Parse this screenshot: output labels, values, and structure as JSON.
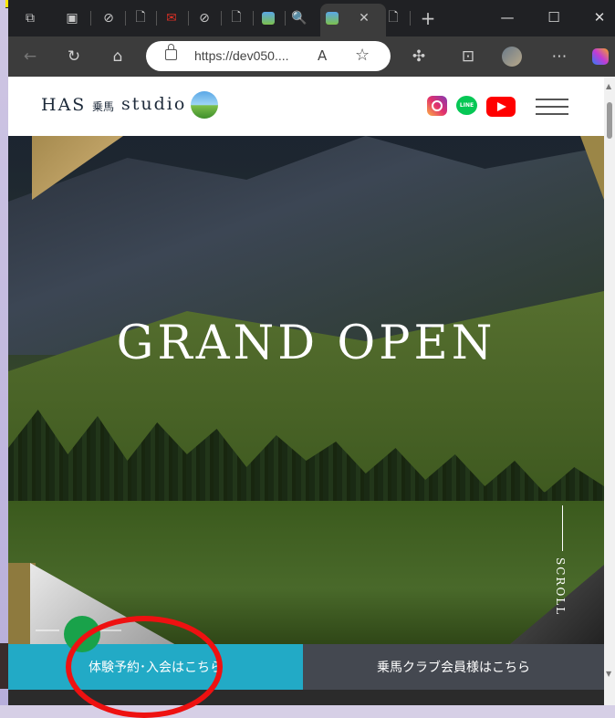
{
  "browser": {
    "tabs": [
      {
        "icon": "workspace-icon"
      },
      {
        "icon": "tab-actions-icon"
      },
      {
        "icon": "blocked-icon"
      },
      {
        "icon": "page-icon"
      },
      {
        "icon": "gmail-icon"
      },
      {
        "icon": "blocked-icon"
      },
      {
        "icon": "page-icon"
      },
      {
        "icon": "site-icon"
      },
      {
        "icon": "search-icon"
      },
      {
        "icon": "site-icon",
        "active": true
      }
    ],
    "new_tab_symbol": "+",
    "close_symbol": "✕",
    "window_controls": {
      "minimize": "—",
      "maximize": "☐",
      "close": "✕"
    },
    "address": "https://dev050....",
    "read_aloud": "A",
    "favorite": "☆"
  },
  "site": {
    "logo": {
      "has": "HAS",
      "jp": "乗馬",
      "studio": "studio"
    },
    "social": {
      "line_label": "LINE"
    },
    "hero": {
      "title": "GRAND OPEN",
      "scroll_label": "SCROLL"
    },
    "cta": {
      "left": "体験予約･入会はこちら",
      "right": "乗馬クラブ会員様はこちら"
    }
  },
  "colors": {
    "cta_left": "#22aac6",
    "cta_right": "#444850",
    "annotation": "#ee1111"
  }
}
